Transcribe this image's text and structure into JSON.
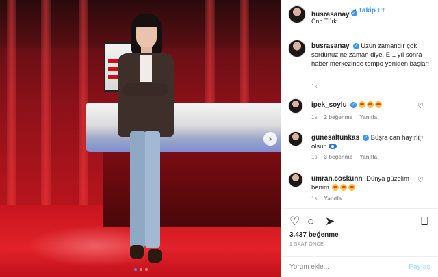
{
  "post": {
    "user": "busrasanay",
    "follow_label": "Takip Et",
    "location": "Cnn Türk",
    "caption": "Uzun zamandır çok sordunuz ne zaman diye. E 1 yıl sonra haber merkezinde tempo yeniden başlar!",
    "caption_time": "1s",
    "likes": "3.437 beğenme",
    "posted_ago": "1 SAAT ÖNCE",
    "carousel": {
      "slides": 3,
      "active": 1
    }
  },
  "comments": [
    {
      "user": "ipek_soylu",
      "verified": true,
      "text": "",
      "emoji_count": 3,
      "time": "1s",
      "likes": "2 beğenme",
      "reply": "Yanıtla"
    },
    {
      "user": "gunesaltunkas",
      "verified": true,
      "text": "Büşra can hayırlı olsun",
      "emoji": "evil-eye-icon",
      "time": "1s",
      "likes": "3 beğenme",
      "reply": "Yanıtla"
    },
    {
      "user": "umran.coskunn",
      "verified": false,
      "text": "Dünya güzelim benim",
      "emoji_count": 3,
      "time": "1s",
      "likes": "",
      "reply": "Yanıtla"
    }
  ],
  "comment_input": {
    "placeholder": "Yorum ekle...",
    "post_label": "Paylaş"
  },
  "colors": {
    "accent": "#3897f0",
    "text": "#262626",
    "muted": "#8e8e8e",
    "post_disabled": "#b2dffc"
  }
}
